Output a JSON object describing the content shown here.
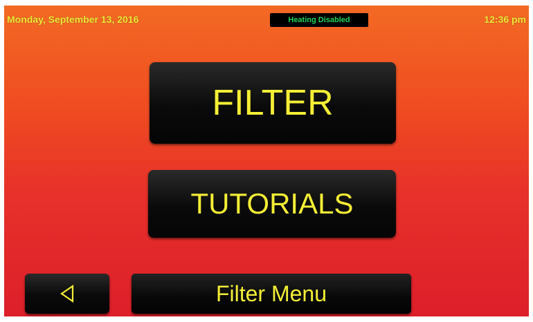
{
  "header": {
    "date": "Monday, September 13, 2016",
    "status": "Heating Disabled",
    "time": "12:36 pm"
  },
  "menu": {
    "filter_label": "FILTER",
    "tutorials_label": "TUTORIALS"
  },
  "footer": {
    "back_icon": "back-triangle-icon",
    "title": "Filter Menu"
  },
  "colors": {
    "text_accent": "#f4ee35",
    "status_text": "#22d45a",
    "background_top": "#f36a23",
    "background_bottom": "#dd1f2a",
    "button_bg": "#0a0a0a"
  }
}
